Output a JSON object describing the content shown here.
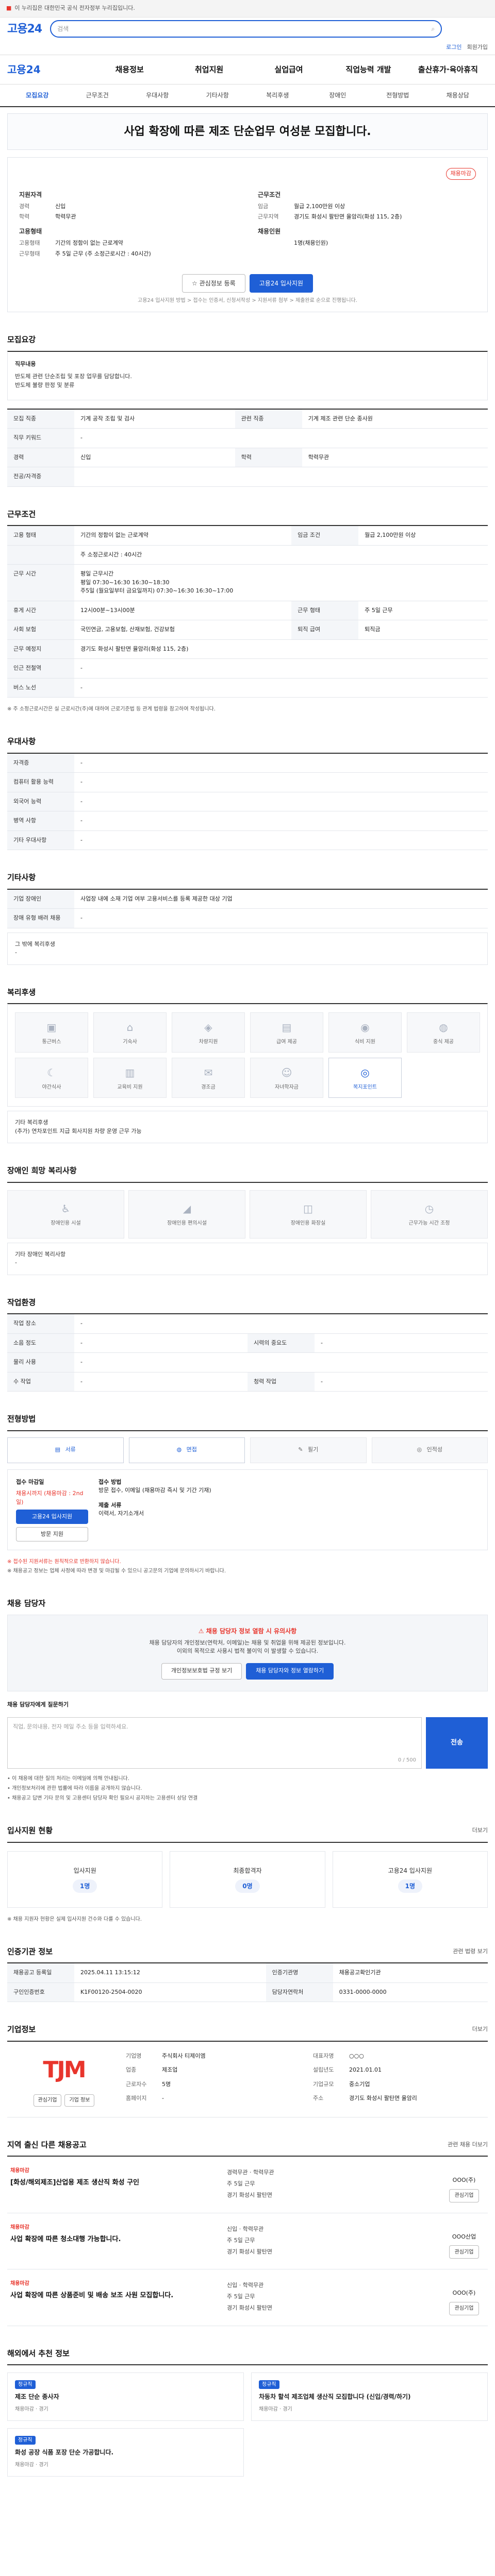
{
  "topbar": {
    "text": "이 누리집은 대한민국 공식 전자정부 누리집입니다."
  },
  "gnb": {
    "brand": "고용24",
    "search_placeholder": "검색"
  },
  "subline": {
    "login": "로그인",
    "join": "회원가입",
    "sitemap": "전체메뉴"
  },
  "menu": {
    "home": "고용24",
    "items": [
      "채용정보",
      "취업지원",
      "실업급여",
      "직업능력 개발",
      "출산휴가·육아휴직"
    ]
  },
  "tabs": [
    "모집요강",
    "근무조건",
    "우대사항",
    "기타사항",
    "복리후생",
    "장애인",
    "전형방법",
    "채용상담"
  ],
  "title": "사업 확장에 따른 제조 단순업무 여성분 모집합니다.",
  "info": {
    "badge": "채용마감",
    "left_h1": "지원자격",
    "left": [
      [
        "경력",
        "신입"
      ],
      [
        "학력",
        "학력무관"
      ]
    ],
    "left_h2": "고용형태",
    "left2": [
      [
        "고용형태",
        "기간의 정함이 없는 근로계약"
      ],
      [
        "근무형태",
        "주 5일 근무 (주 소정근로시간 : 40시간)"
      ]
    ],
    "right_h1": "근무조건",
    "right": [
      [
        "임금",
        "월급 2,100만원 이상"
      ],
      [
        "근무지역",
        "경기도 화성시 팔탄면 율암리(화성 115, 2층)"
      ]
    ],
    "right_h2": "채용인원",
    "right2": [
      [
        "",
        "1명(채용인원)"
      ]
    ]
  },
  "actions": {
    "scrap": "관심정보 등록",
    "apply": "고용24 입사지원"
  },
  "note": "고용24 입사지원 방법 > 접수는 인증서, 신청서작성 > 지원서류 첨부 > 제출완료 순으로 진행됩니다.",
  "sec_recruit": {
    "title": "모집요강",
    "job_title_h": "직무내용",
    "job_desc": "반도체 관련 단순조립 및 포장 업무를 담당합니다.\n반도체 불량 판정 및 분류",
    "rows": [
      [
        "모집 직종",
        "기계 공작 조립 및 검사",
        "관련 직종",
        "기계 제조 관련 단순 종사원"
      ],
      [
        "직무 키워드",
        "-",
        "",
        ""
      ],
      [
        "경력",
        "신입",
        "학력",
        "학력무관"
      ],
      [
        "전공/자격증",
        "",
        "",
        ""
      ]
    ]
  },
  "sec_work": {
    "title": "근무조건",
    "rows": [
      [
        "고용 형태",
        "기간의 정함이 없는 근로계약",
        "임금 조건",
        "월급 2,100만원 이상"
      ],
      [
        "",
        "주 소정근로시간 : 40시간",
        "",
        ""
      ],
      [
        "근무 시간",
        "평일 근무시간\n평일 07:30~16:30  16:30~18:30\n주5일 (월요일부터 금요일까지) 07:30~16:30 16:30~17:00",
        "",
        ""
      ],
      [
        "휴게 시간",
        "12시00분~13시00분",
        "근무 형태",
        "주 5일 근무"
      ],
      [
        "사회 보험",
        "국민연금, 고용보험, 산재보험, 건강보험",
        "퇴직 급여",
        "퇴직금"
      ],
      [
        "근무 예정지",
        "경기도 화성시 팔탄면 율암리(화성 115, 2층)",
        "",
        ""
      ],
      [
        "인근 전철역",
        "-",
        "",
        ""
      ],
      [
        "버스 노선",
        "-",
        "",
        ""
      ]
    ],
    "footnote": "※ 주 소정근로시간은 실 근로시간(주)에 대하여 근로기준법 등 관계 법령을 참고하여 작성됩니다."
  },
  "sec_prefer": {
    "title": "우대사항",
    "rows": [
      [
        "자격증",
        "-"
      ],
      [
        "컴퓨터 활용 능력",
        "-"
      ],
      [
        "외국어 능력",
        "-"
      ],
      [
        "병역 사항",
        "-"
      ],
      [
        "기타 우대사항",
        "-"
      ]
    ]
  },
  "sec_etc": {
    "title": "기타사항",
    "rows": [
      [
        "기업 장애인",
        "사업장 내에 소재 기업 여부 고용서비스를 등록 제공한 대상 기업"
      ],
      [
        "장애 유형 배려 채용",
        "-"
      ]
    ],
    "extra_label": "그 밖에 복리후생",
    "extra": "-"
  },
  "sec_welfare": {
    "title": "복리후생",
    "items": [
      "통근버스",
      "기숙사",
      "차량지원",
      "급여 제공",
      "식비 지원",
      "중식 제공",
      "야간식사",
      "교육비 지원",
      "경조금",
      "자녀학자금",
      "",
      "복지포인트"
    ],
    "active_index": 11,
    "sub_label": "기타 복리후생",
    "sub_text": "(추가) 연차포인트 지급 회사지원 차량 운영 근무 가능"
  },
  "sec_disabled": {
    "title": "장애인 희망 복리사항",
    "items": [
      "장애인용 시설",
      "장애인용 편의시설",
      "장애인용 화장실",
      "근무가능 시간 조정"
    ],
    "sub_label": "기타 장애인 복리사항",
    "sub_text": "-"
  },
  "sec_workenv": {
    "title": "작업환경",
    "rows": [
      [
        "작업 장소",
        "-",
        "",
        ""
      ],
      [
        "소음 정도",
        "-",
        "시력의 중요도",
        "-"
      ],
      [
        "물리 사용",
        "-",
        "",
        ""
      ],
      [
        "수 작업",
        "-",
        "청력 작업",
        "-"
      ]
    ]
  },
  "sec_process": {
    "title": "전형방법",
    "items": [
      "서류",
      "면접",
      "필기",
      "인적성"
    ],
    "apply_h": "접수 마감일",
    "apply_date": "채용시까지 (채용마감 : 2nd일)",
    "apply_btn": "고용24 입사지원",
    "apply_btn2": "방문 지원",
    "method_h": "접수 방법",
    "method": "방문 접수, 이메일 (채용마감 즉시 및 기간 기재)",
    "docs_h": "제출 서류",
    "docs": "이력서, 자기소개서",
    "notes": [
      "※ 접수된 지원서류는 원칙적으로 반환하지 않습니다.",
      "※ 채용공고 정보는 업체 사정에 따라 변경 및 마감될 수 있으니 공고문의 기업에 문의하시기 바랍니다."
    ]
  },
  "sec_consult": {
    "title": "채용 담당자",
    "q": "채용 담당자 정보 열람 시 유의사항",
    "desc": "채용 담당자의 개인정보(연락처, 이메일)는 채용 및 취업을 위해 제공된 정보입니다.\n이외의 목적으로 사용시 법적 불이익 이 발생할 수 있습니다.",
    "btn1": "개인정보보호법 규정 보기",
    "btn2": "채용 담당자와 정보 열람하기",
    "inquiry_label": "채용 담당자에게 질문하기",
    "inquiry_placeholder": "직업, 문의내용, 전자 메일 주소 등을 입력하세요.",
    "inquiry_count": "0 / 500",
    "send": "전송",
    "bullets": [
      "• 이 채용에 대한 질의 처리는 이메일에 의해 안내됩니다.",
      "• 개인정보처리에 관한 법률에 따라 이름을 공개하지 않습니다.",
      "• 채용공고 답변 기타 문의 및 고용센터 담당자 확인 필요시 공지하는 고용센터 상담 연결"
    ]
  },
  "sec_status": {
    "title": "입사지원 현황",
    "more": "더보기",
    "items": [
      [
        "입사지원",
        "1명"
      ],
      [
        "최종합격자",
        "0명"
      ],
      [
        "고용24 입사지원",
        "1명"
      ]
    ],
    "note": "※ 채용 지원자 현황은 실제 입사지원 건수와 다를 수 있습니다."
  },
  "sec_notice": {
    "title": "인증기관 정보",
    "more": "관련 법령 보기",
    "rows": [
      [
        "채용공고 등록일",
        "2025.04.11 13:15:12",
        "인증기관명",
        "채용공고확인기관"
      ],
      [
        "구인인증번호",
        "K1F00120-2504-0020",
        "담당자연락처",
        "0331-0000-0000"
      ]
    ]
  },
  "sec_company": {
    "title": "기업정보",
    "more": "더보기",
    "logo": "TJM",
    "btn1": "관심기업",
    "btn2": "기업 정보",
    "info": [
      [
        "기업명",
        "주식회사 티제이엠"
      ],
      [
        "대표자명",
        "○○○"
      ],
      [
        "업종",
        "제조업"
      ],
      [
        "설립년도",
        "2021.01.01"
      ],
      [
        "근로자수",
        "5명"
      ],
      [
        "기업규모",
        "중소기업"
      ],
      [
        "홈페이지",
        "-"
      ],
      [
        "주소",
        "경기도 화성시 팔탄면 율암리"
      ]
    ]
  },
  "sec_more": {
    "title": "지역 출신 다른 채용공고",
    "more": "관련 채용 더보기",
    "jobs": [
      {
        "cat": "채용마감",
        "title": "[화성/해외제조]산업용 제조 생산직 화성 구인",
        "meta": [
          "경력무관 · 학력무관",
          "주 5일 근무",
          "경기 화성시 팔탄면"
        ],
        "company": "OOO(주)",
        "btn": "관심기업"
      },
      {
        "cat": "채용마감",
        "title": "사업 확장에 따른 청소대행 가능합니다.",
        "meta": [
          "신입 · 학력무관",
          "주 5일 근무",
          "경기 화성시 팔탄면"
        ],
        "company": "OOO산업",
        "btn": "관심기업"
      },
      {
        "cat": "채용마감",
        "title": "사업 확장에 따른 상품준비 및 배송 보조 사원 모집합니다.",
        "meta": [
          "신입 · 학력무관",
          "주 5일 근무",
          "경기 화성시 팔탄면"
        ],
        "company": "OOO(주)",
        "btn": "관심기업"
      }
    ]
  },
  "sec_similar": {
    "title": "해외에서 추천 정보",
    "cards": [
      {
        "tag": "정규직",
        "title": "제조 단순 종사자",
        "meta": "채용마감 · 경기"
      },
      {
        "tag": "정규직",
        "title": "차동차 할석 제조업체 생산직 모집합니다 (신입/경력/하기)",
        "meta": "채용마감 · 경기"
      },
      {
        "tag": "정규직",
        "title": "화성 공장 식품 포장 단순 가공합니다.",
        "meta": "채용마감 · 경기"
      }
    ]
  }
}
